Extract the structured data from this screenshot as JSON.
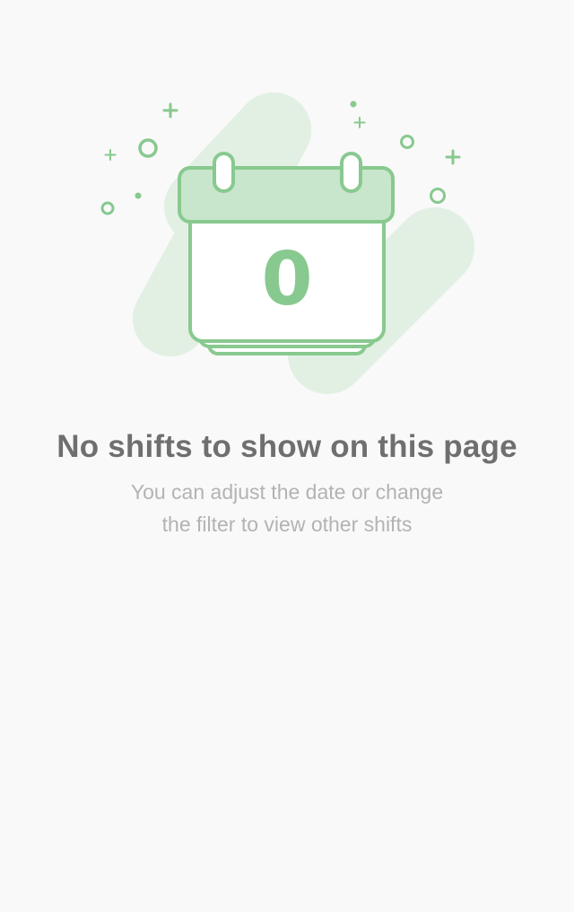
{
  "empty_state": {
    "illustration": {
      "icon": "calendar-icon",
      "calendar_number": "0",
      "accent_color": "#88c98f",
      "fill_color": "#c8e6cb",
      "blob_color": "#e1f0e3"
    },
    "title": "No shifts to show on this page",
    "subtitle_line1": "You can adjust the date or change",
    "subtitle_line2": "the filter to view other shifts"
  }
}
